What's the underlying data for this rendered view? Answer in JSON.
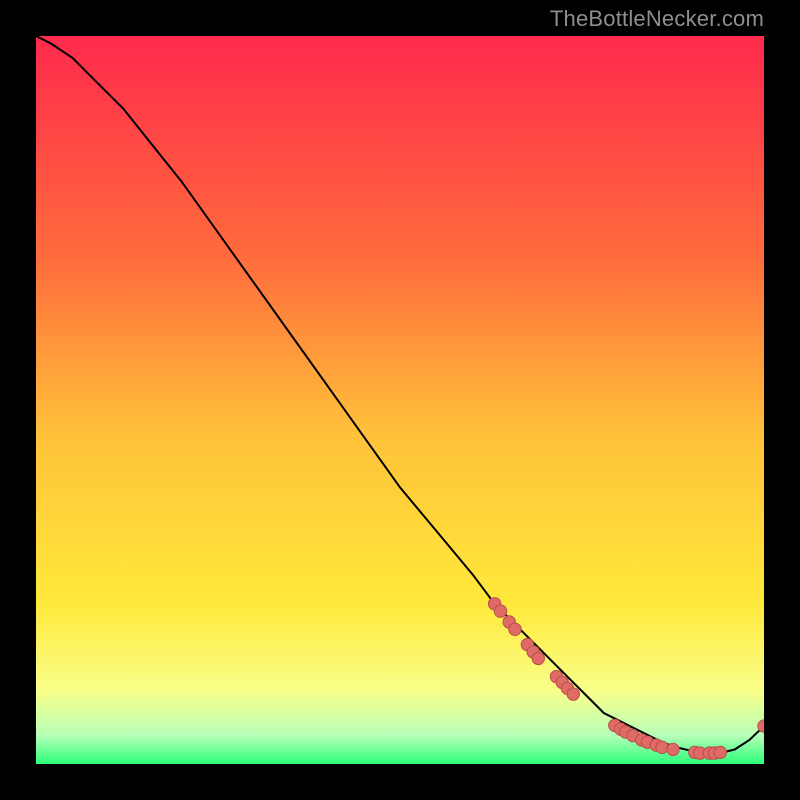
{
  "watermark": "TheBottleNecker.com",
  "colors": {
    "gradient_top": "#ff2a4d",
    "gradient_mid1": "#ff6a3c",
    "gradient_mid2": "#ffc23a",
    "gradient_mid3": "#ffe93a",
    "gradient_mid4": "#f8ff8a",
    "gradient_mid5": "#b8ffb8",
    "gradient_bottom": "#2dff7a",
    "line": "#000000",
    "dot_fill": "#e06a66",
    "dot_stroke": "#b84f4b"
  },
  "chart_data": {
    "type": "line",
    "title": "",
    "xlabel": "",
    "ylabel": "",
    "xlim": [
      0,
      100
    ],
    "ylim": [
      0,
      100
    ],
    "series": [
      {
        "name": "curve",
        "x": [
          0,
          2,
          5,
          8,
          12,
          16,
          20,
          25,
          30,
          35,
          40,
          45,
          50,
          55,
          60,
          63,
          66,
          68,
          70,
          72,
          74,
          76,
          78,
          80,
          82,
          84,
          86,
          88,
          90,
          92,
          94,
          96,
          98,
          100
        ],
        "y": [
          100,
          99,
          97,
          94,
          90,
          85,
          80,
          73,
          66,
          59,
          52,
          45,
          38,
          32,
          26,
          22,
          19,
          17,
          15,
          13,
          11,
          9,
          7,
          6,
          5,
          4,
          3,
          2.3,
          1.8,
          1.5,
          1.5,
          2.0,
          3.3,
          5.2
        ]
      }
    ],
    "dots": {
      "name": "highlighted-points",
      "points": [
        {
          "x": 63.0,
          "y": 22.0
        },
        {
          "x": 63.8,
          "y": 21.0
        },
        {
          "x": 65.0,
          "y": 19.5
        },
        {
          "x": 65.8,
          "y": 18.5
        },
        {
          "x": 67.5,
          "y": 16.4
        },
        {
          "x": 68.3,
          "y": 15.4
        },
        {
          "x": 69.0,
          "y": 14.5
        },
        {
          "x": 71.5,
          "y": 12.0
        },
        {
          "x": 72.3,
          "y": 11.2
        },
        {
          "x": 73.0,
          "y": 10.4
        },
        {
          "x": 73.8,
          "y": 9.6
        },
        {
          "x": 79.5,
          "y": 5.3
        },
        {
          "x": 80.3,
          "y": 4.8
        },
        {
          "x": 81.0,
          "y": 4.4
        },
        {
          "x": 82.0,
          "y": 3.9
        },
        {
          "x": 83.2,
          "y": 3.3
        },
        {
          "x": 84.0,
          "y": 3.0
        },
        {
          "x": 85.2,
          "y": 2.6
        },
        {
          "x": 86.0,
          "y": 2.3
        },
        {
          "x": 87.5,
          "y": 2.0
        },
        {
          "x": 90.5,
          "y": 1.6
        },
        {
          "x": 91.2,
          "y": 1.5
        },
        {
          "x": 92.5,
          "y": 1.5
        },
        {
          "x": 93.2,
          "y": 1.5
        },
        {
          "x": 94.0,
          "y": 1.6
        },
        {
          "x": 100.0,
          "y": 5.2
        }
      ],
      "radius": 6.2
    }
  }
}
